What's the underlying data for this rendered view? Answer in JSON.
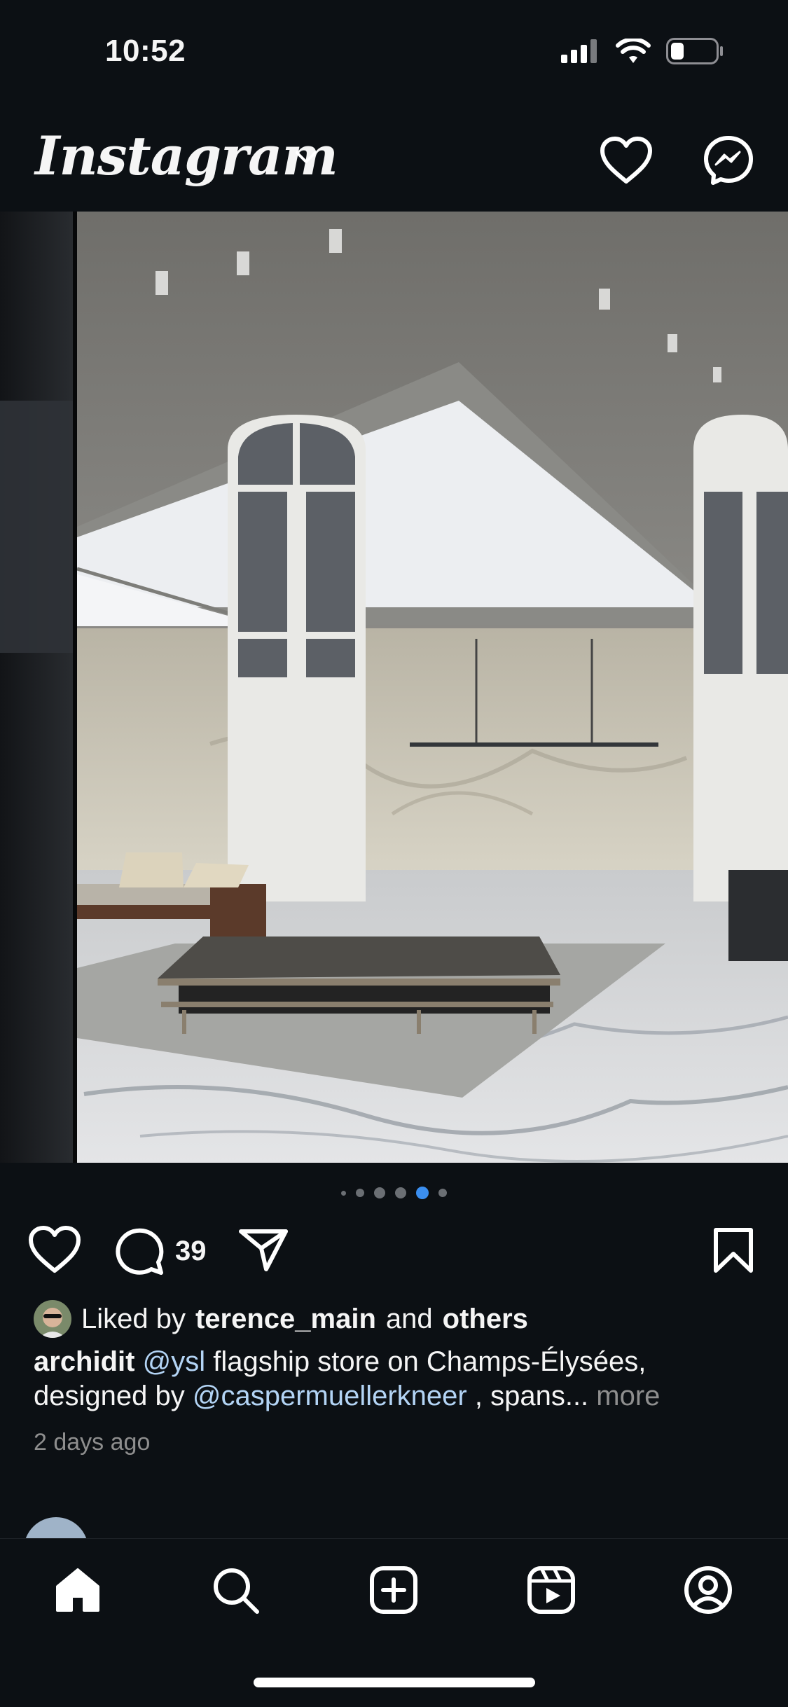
{
  "status_bar": {
    "time": "10:52"
  },
  "header": {
    "logo": "Instagram"
  },
  "post": {
    "carousel": {
      "count": 6,
      "active_index": 4
    },
    "comment_count": "39",
    "likes": {
      "prefix": "Liked by",
      "user": "terence_main",
      "middle": "and",
      "suffix": "others"
    },
    "caption": {
      "author": "archidit",
      "mention1": "@ysl",
      "text1": "flagship store on Champs-Élysées,",
      "text2": "designed by",
      "mention2": "@caspermuellerkneer",
      "text3": ", spans...",
      "more": "more"
    },
    "timestamp": "2 days ago"
  },
  "colors": {
    "background": "#0c1014",
    "mention": "#b3d4f5",
    "active_dot": "#3b8ff0",
    "muted": "#8e8e8e"
  },
  "icons": [
    "signal-icon",
    "wifi-icon",
    "battery-icon",
    "chevron-down-icon",
    "heart-icon",
    "messenger-icon",
    "comment-icon",
    "share-icon",
    "bookmark-icon",
    "home-icon",
    "search-icon",
    "create-icon",
    "reels-icon",
    "profile-icon"
  ]
}
